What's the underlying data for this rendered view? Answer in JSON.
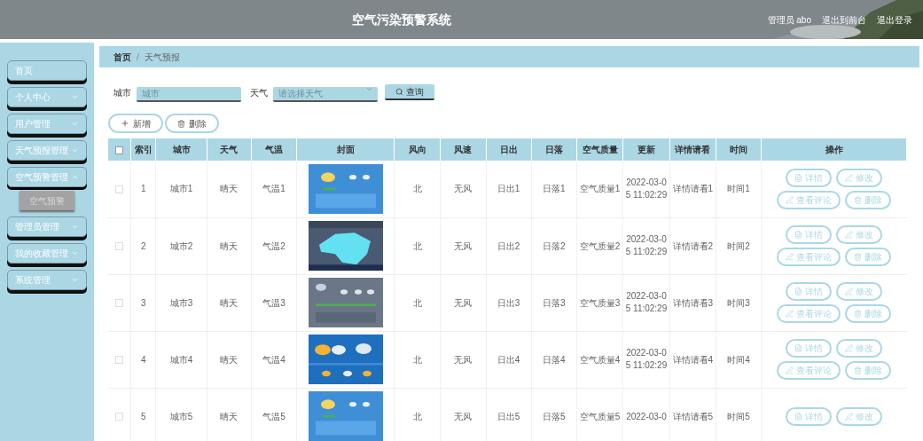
{
  "header": {
    "title": "空气污染预警系统",
    "user": "管理员 abo",
    "links": [
      "退出到前台",
      "退出登录"
    ]
  },
  "sidebar": {
    "items": [
      {
        "label": "首页",
        "kind": "link",
        "expanded": false
      },
      {
        "label": "个人中心",
        "kind": "menu",
        "expanded": false
      },
      {
        "label": "用户管理",
        "kind": "menu",
        "expanded": false
      },
      {
        "label": "天气预报管理",
        "kind": "menu",
        "expanded": false
      },
      {
        "label": "空气预警管理",
        "kind": "menu",
        "expanded": true,
        "children": [
          {
            "label": "空气预警",
            "hovered": true
          }
        ]
      },
      {
        "label": "管理员管理",
        "kind": "menu",
        "expanded": false
      },
      {
        "label": "我的收藏管理",
        "kind": "menu",
        "expanded": false
      },
      {
        "label": "系统管理",
        "kind": "menu",
        "expanded": false
      }
    ]
  },
  "breadcrumb": {
    "separator": "/",
    "items": [
      "首页",
      "天气预报"
    ]
  },
  "search": {
    "fields": [
      {
        "label": "城市",
        "placeholder": "城市",
        "kind": "text"
      },
      {
        "label": "天气",
        "placeholder": "请选择天气",
        "kind": "select"
      }
    ],
    "button": "查询"
  },
  "toolbar": [
    {
      "label": "新增",
      "kind": "add"
    },
    {
      "label": "删除",
      "kind": "delete"
    }
  ],
  "table": {
    "all_checked": false,
    "columns": [
      "索引",
      "城市",
      "天气",
      "气温",
      "封面",
      "风向",
      "风速",
      "日出",
      "日落",
      "空气质量",
      "更新",
      "详情请看",
      "时间",
      "操作"
    ],
    "rows": [
      {
        "cells": [
          "1",
          "城市1",
          "晴天",
          "气温1",
          "",
          "北",
          "无风",
          "日出1",
          "日落1",
          "空气质量1",
          "2022-03-05 11:02:29",
          "详情请看1",
          "时间1"
        ],
        "checked": false,
        "cover": {
          "kind": "picture"
        },
        "actions": [
          {
            "label": "详情",
            "kind": "detail"
          },
          {
            "label": "修改",
            "kind": "edit"
          },
          {
            "label": "查看评论",
            "kind": "edit"
          },
          {
            "label": "删除",
            "kind": "delete"
          }
        ]
      },
      {
        "cells": [
          "2",
          "城市2",
          "晴天",
          "气温2",
          "",
          "北",
          "无风",
          "日出2",
          "日落2",
          "空气质量2",
          "2022-03-05 11:02:29",
          "详情请看2",
          "时间2"
        ],
        "checked": false,
        "cover": {
          "kind": "picture"
        },
        "actions": [
          {
            "label": "详情",
            "kind": "detail"
          },
          {
            "label": "修改",
            "kind": "edit"
          },
          {
            "label": "查看评论",
            "kind": "edit"
          },
          {
            "label": "删除",
            "kind": "delete"
          }
        ]
      },
      {
        "cells": [
          "3",
          "城市3",
          "晴天",
          "气温3",
          "",
          "北",
          "无风",
          "日出3",
          "日落3",
          "空气质量3",
          "2022-03-05 11:02:29",
          "详情请看3",
          "时间3"
        ],
        "checked": false,
        "cover": {
          "kind": "picture"
        },
        "actions": [
          {
            "label": "详情",
            "kind": "detail"
          },
          {
            "label": "修改",
            "kind": "edit"
          },
          {
            "label": "查看评论",
            "kind": "edit"
          },
          {
            "label": "删除",
            "kind": "delete"
          }
        ]
      },
      {
        "cells": [
          "4",
          "城市4",
          "晴天",
          "气温4",
          "",
          "北",
          "无风",
          "日出4",
          "日落4",
          "空气质量4",
          "2022-03-05 11:02:29",
          "详情请看4",
          "时间4"
        ],
        "checked": false,
        "cover": {
          "kind": "picture"
        },
        "actions": [
          {
            "label": "详情",
            "kind": "detail"
          },
          {
            "label": "修改",
            "kind": "edit"
          },
          {
            "label": "查看评论",
            "kind": "edit"
          },
          {
            "label": "删除",
            "kind": "delete"
          }
        ]
      },
      {
        "cells": [
          "5",
          "城市5",
          "晴天",
          "气温5",
          "",
          "北",
          "无风",
          "日出5",
          "日落5",
          "空气质量5",
          "2022-03-0",
          "详情请看5",
          "时间5"
        ],
        "checked": false,
        "cover": {
          "kind": "picture"
        },
        "actions": [
          {
            "label": "详情",
            "kind": "detail"
          },
          {
            "label": "修改",
            "kind": "edit"
          }
        ]
      }
    ]
  }
}
